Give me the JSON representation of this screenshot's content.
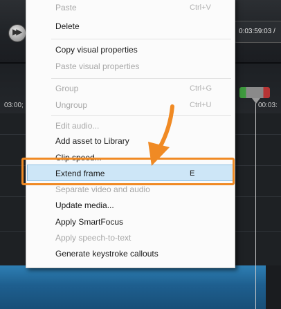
{
  "editor": {
    "time_display": "0:03:59:03 /",
    "ruler_left_label": "03:00;",
    "ruler_right_label": "00:03:"
  },
  "context_menu": {
    "items": [
      {
        "label": "Paste",
        "shortcut": "Ctrl+V",
        "state": "disabled"
      },
      {
        "label": "Delete",
        "shortcut": "",
        "state": "enabled"
      },
      {
        "label": "Copy visual properties",
        "shortcut": "",
        "state": "enabled"
      },
      {
        "label": "Paste visual properties",
        "shortcut": "",
        "state": "disabled"
      },
      {
        "label": "Group",
        "shortcut": "Ctrl+G",
        "state": "disabled"
      },
      {
        "label": "Ungroup",
        "shortcut": "Ctrl+U",
        "state": "disabled"
      },
      {
        "label": "Edit audio...",
        "shortcut": "",
        "state": "disabled"
      },
      {
        "label": "Add asset to Library",
        "shortcut": "",
        "state": "enabled"
      },
      {
        "label": "Clip speed...",
        "shortcut": "",
        "state": "enabled"
      },
      {
        "label": "Extend frame",
        "shortcut": "E",
        "state": "highlighted"
      },
      {
        "label": "Separate video and audio",
        "shortcut": "",
        "state": "disabled"
      },
      {
        "label": "Update media...",
        "shortcut": "",
        "state": "enabled"
      },
      {
        "label": "Apply SmartFocus",
        "shortcut": "",
        "state": "enabled"
      },
      {
        "label": "Apply speech-to-text",
        "shortcut": "",
        "state": "disabled"
      },
      {
        "label": "Generate keystroke callouts",
        "shortcut": "",
        "state": "enabled"
      }
    ]
  },
  "annotation": {
    "highlight_color": "#f08a24",
    "arrow_color": "#f08a24"
  }
}
